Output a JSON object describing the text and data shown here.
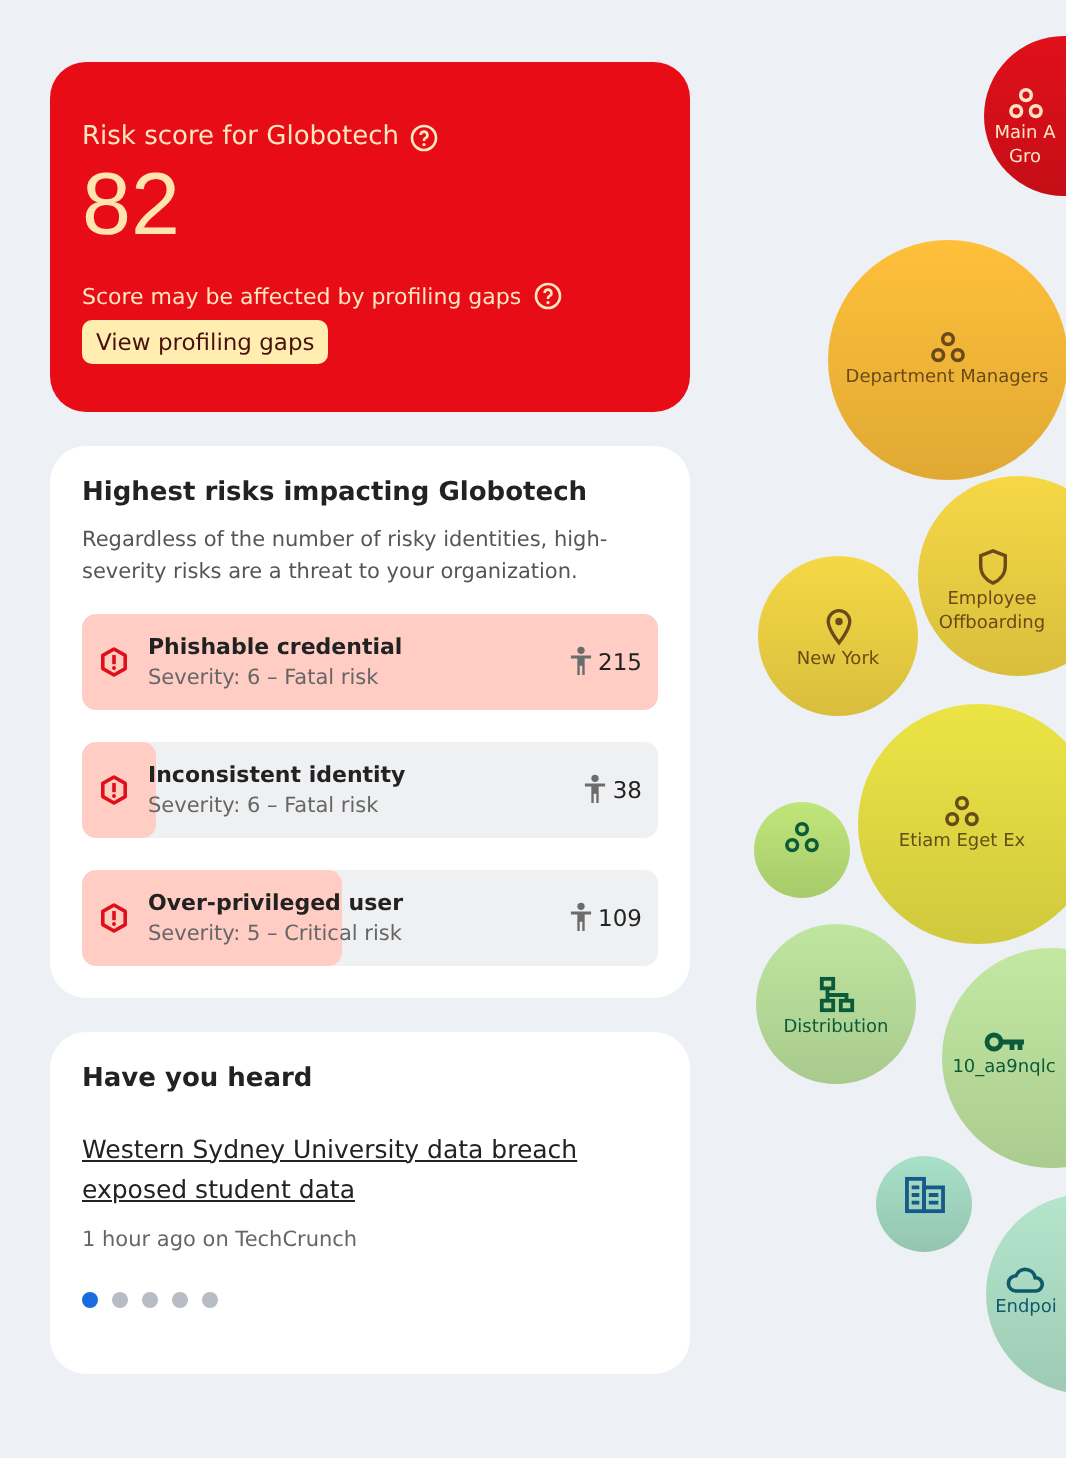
{
  "risk_score": {
    "title": "Risk score for Globotech",
    "score": "82",
    "note": "Score may be affected by profiling gaps",
    "button": "View profiling gaps"
  },
  "highest_risks": {
    "title": "Highest risks impacting Globotech",
    "description": "Regardless of the number of risky identities, high-severity risks are a threat to your organization.",
    "risks": [
      {
        "name": "Phishable credential",
        "severity": "Severity: 6 – Fatal risk",
        "count": "215",
        "level": 1.0
      },
      {
        "name": "Inconsistent identity",
        "severity": "Severity: 6 – Fatal risk",
        "count": "38",
        "level": 0.13
      },
      {
        "name": "Over-privileged user",
        "severity": "Severity: 5 – Critical risk",
        "count": "109",
        "level": 0.45
      }
    ]
  },
  "news": {
    "title": "Have you heard",
    "headline": "Western Sydney University data breach exposed student data",
    "meta": "1 hour ago on TechCrunch",
    "dots": [
      {
        "selected": true
      },
      {
        "selected": false
      },
      {
        "selected": false
      },
      {
        "selected": false
      },
      {
        "selected": false
      }
    ]
  },
  "bubbles": [
    {
      "label_lines": [
        "Main A",
        "Gro"
      ],
      "kind": "group",
      "color": "#e0101a"
    },
    {
      "label_lines": [
        "Department Managers"
      ],
      "kind": "group",
      "color": "#ffc03a"
    },
    {
      "label_lines": [
        "Employee",
        "Offboarding"
      ],
      "kind": "shield",
      "color": "#f6d845"
    },
    {
      "label_lines": [
        "New York"
      ],
      "kind": "pin",
      "color": "#f6d845"
    },
    {
      "label_lines": [
        "Etiam Eget Ex"
      ],
      "kind": "group",
      "color": "#ece445"
    },
    {
      "kind": "group",
      "color": "#bfe67a"
    },
    {
      "label_lines": [
        "Distribution"
      ],
      "kind": "org",
      "color": "#bfe6a0"
    },
    {
      "label_lines": [
        "10_aa9nqlc"
      ],
      "kind": "key",
      "color": "#c2e8a2"
    },
    {
      "kind": "building",
      "color": "#a8e0c8"
    },
    {
      "label_lines": [
        "Endpoi"
      ],
      "kind": "cloud",
      "color": "#b4e6cc"
    }
  ]
}
